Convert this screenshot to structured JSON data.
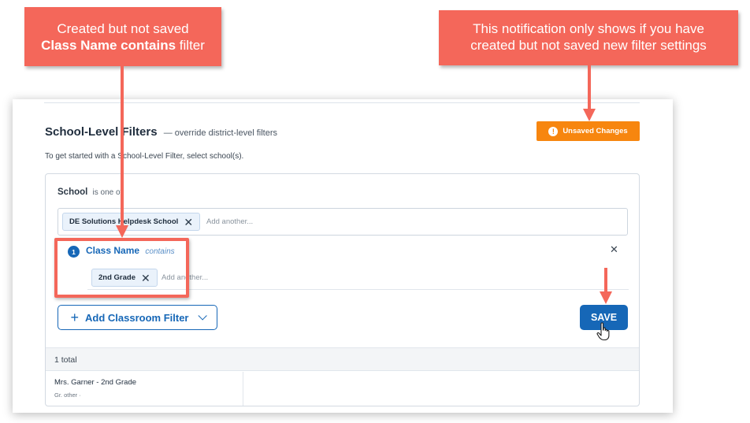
{
  "annotations": {
    "callout_left_line1": "Created but not saved",
    "callout_left_bold": "Class Name contains",
    "callout_left_tail": " filter",
    "callout_right_line1": "This notification only shows if you have",
    "callout_right_line2": "created but not saved new filter settings",
    "color": "#f4675a"
  },
  "section": {
    "title": "School-Level Filters",
    "subtitle": "— override district-level filters",
    "intro": "To get started with a School-Level Filter, select school(s).",
    "unsaved_badge": "Unsaved Changes",
    "unsaved_icon": "exclamation-icon"
  },
  "school_filter": {
    "label": "School",
    "operator": "is one of",
    "selected": [
      "DE Solutions Helpdesk School"
    ],
    "placeholder": "Add another..."
  },
  "class_filter": {
    "number": "1",
    "label": "Class Name",
    "operator": "contains",
    "selected": [
      "2nd Grade"
    ],
    "placeholder": "Add another..."
  },
  "buttons": {
    "add_classroom_filter": "Add Classroom Filter",
    "save": "SAVE"
  },
  "results": {
    "total": "1 total",
    "items": [
      {
        "name": "Mrs. Garner - 2nd Grade",
        "sub": "Gr. other ·"
      }
    ]
  },
  "colors": {
    "primary": "#1667b7",
    "warning": "#f7860f",
    "annotation": "#f4675a"
  }
}
